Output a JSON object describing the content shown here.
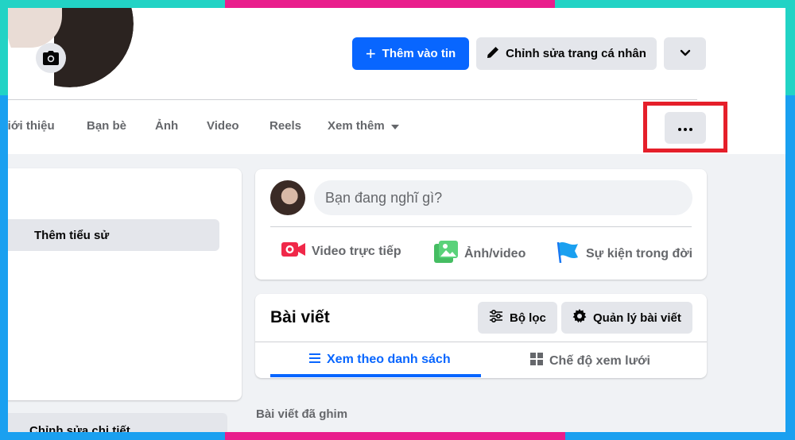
{
  "header": {
    "add_story_label": "Thêm vào tin",
    "edit_profile_label": "Chỉnh sửa trang cá nhân"
  },
  "tabs": [
    {
      "label": "Giới thiệu"
    },
    {
      "label": "Bạn bè"
    },
    {
      "label": "Ảnh"
    },
    {
      "label": "Video"
    },
    {
      "label": "Reels"
    },
    {
      "label": "Xem thêm"
    }
  ],
  "intro": {
    "add_bio_label": "Thêm tiểu sử",
    "edit_details_label": "Chỉnh sửa chi tiết"
  },
  "composer": {
    "placeholder": "Bạn đang nghĩ gì?",
    "actions": [
      {
        "label": "Video trực tiếp",
        "color": "#f02849"
      },
      {
        "label": "Ảnh/video",
        "color": "#45bd62"
      },
      {
        "label": "Sự kiện trong đời",
        "color": "#1aa0f0"
      }
    ]
  },
  "posts": {
    "title": "Bài viết",
    "filter_label": "Bộ lọc",
    "manage_label": "Quản lý bài viết",
    "list_view_label": "Xem theo danh sách",
    "grid_view_label": "Chế độ xem lưới",
    "pinned_label": "Bài viết đã ghim"
  },
  "colors": {
    "accent": "#0866ff",
    "highlight_box": "#e51f2a",
    "frame_teal": "#22d3c5",
    "frame_pink": "#e91e8c",
    "frame_blue": "#1aa0f0"
  }
}
